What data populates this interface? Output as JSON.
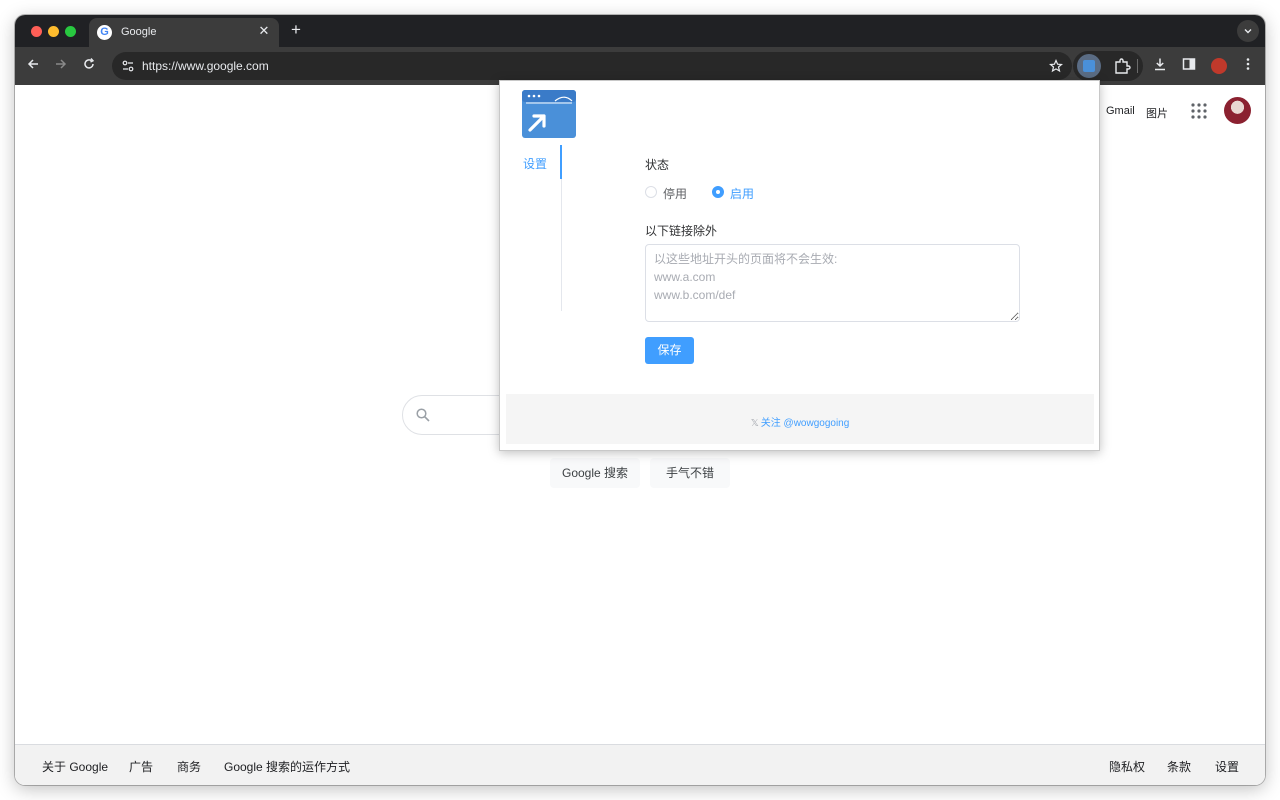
{
  "browser": {
    "tab_title": "Google",
    "tab_favicon": "G",
    "tab_close": "✕",
    "new_tab": "+",
    "url": "https://www.google.com",
    "icons": {
      "back": "back-arrow-icon",
      "forward": "forward-arrow-icon",
      "reload": "reload-icon",
      "star": "star-icon"
    }
  },
  "google": {
    "top_links": [
      "Gmail",
      "图片"
    ],
    "buttons": [
      "Google 搜索",
      "手气不错"
    ],
    "footer_left": [
      "关于 Google",
      "广告",
      "商务",
      "Google 搜索的运作方式"
    ],
    "footer_right": [
      "隐私权",
      "条款",
      "设置"
    ]
  },
  "popup": {
    "nav_label": "设置",
    "status_label": "状态",
    "radio_off": "停用",
    "radio_on": "启用",
    "radio_on_selected": true,
    "exclude_label": "以下链接除外",
    "textarea_placeholder": "以这些地址开头的页面将不会生效:\nwww.a.com\nwww.b.com/def",
    "save_label": "保存",
    "follow_text": "关注 @wowgogoing",
    "accent_color": "#409eff"
  }
}
